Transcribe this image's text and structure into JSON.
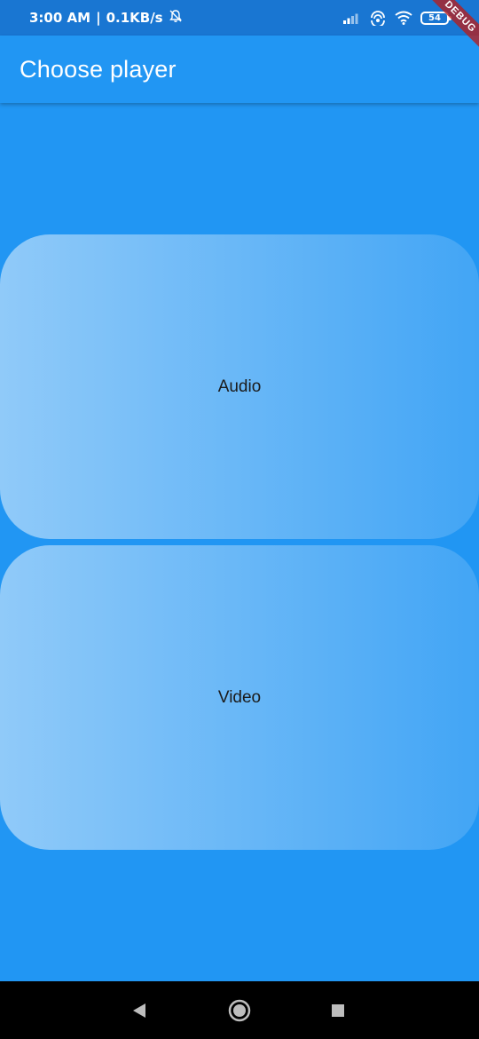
{
  "status_bar": {
    "time": "3:00 AM",
    "separator": "|",
    "network_speed": "0.1KB/s",
    "battery_level": "54",
    "icons": [
      "bell-off-icon",
      "signal-icon",
      "hotspot-icon",
      "wifi-icon",
      "battery-icon"
    ]
  },
  "debug_banner": {
    "label": "DEBUG"
  },
  "app_bar": {
    "title": "Choose player"
  },
  "options": [
    {
      "label": "Audio"
    },
    {
      "label": "Video"
    }
  ],
  "nav_bar": {
    "icons": [
      "back-icon",
      "home-icon",
      "recents-icon"
    ]
  },
  "colors": {
    "primary": "#2196F3",
    "status_bar": "#1976D2",
    "card_gradient_start": "#90CAF9",
    "card_gradient_end": "#42A5F5",
    "nav_bar": "#000000",
    "debug_banner": "#B71C1C"
  }
}
